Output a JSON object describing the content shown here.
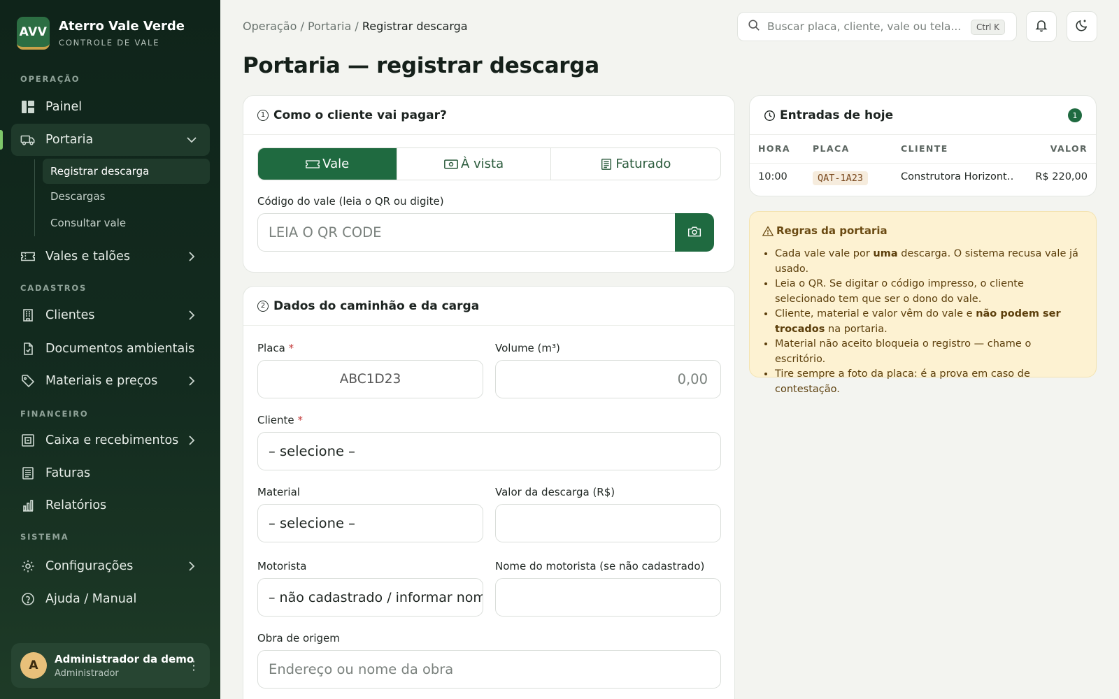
{
  "brand": {
    "logo": "AVV",
    "name": "Aterro Vale Verde",
    "subtitle": "CONTROLE DE VALE"
  },
  "sidebar": {
    "sections": {
      "operacao": "OPERAÇÃO",
      "cadastros": "CADASTROS",
      "financeiro": "FINANCEIRO",
      "sistema": "SISTEMA"
    },
    "items": {
      "painel": "Painel",
      "portaria": "Portaria",
      "vales": "Vales e talões",
      "clientes": "Clientes",
      "documentos": "Documentos ambientais",
      "materiais": "Materiais e preços",
      "caixa": "Caixa e recebimentos",
      "faturas": "Faturas",
      "relatorios": "Relatórios",
      "config": "Configurações",
      "ajuda": "Ajuda / Manual"
    },
    "subitems": {
      "registrar": "Registrar descarga",
      "descargas": "Descargas",
      "consultar": "Consultar vale"
    },
    "user": {
      "initial": "A",
      "name": "Administrador da demo",
      "role": "Administrador"
    }
  },
  "header": {
    "breadcrumb": {
      "a": "Operação",
      "sep": "/",
      "b": "Portaria",
      "c": "Registrar descarga"
    },
    "search_placeholder": "Buscar placa, cliente, vale ou tela...",
    "shortcut": "Ctrl K",
    "title": "Portaria — registrar descarga"
  },
  "payment": {
    "step": "1",
    "title": "Como o cliente vai pagar?",
    "options": {
      "vale": "Vale",
      "avista": "À vista",
      "faturado": "Faturado"
    },
    "selected": "Vale",
    "code_label": "Código do vale (leia o QR ou digite)",
    "code_placeholder": "LEIA O QR CODE"
  },
  "cargo": {
    "step": "2",
    "title": "Dados do caminhão e da carga",
    "placa_label": "Placa",
    "placa_value": "ABC1D23",
    "volume_label": "Volume (m³)",
    "volume_value": "0,00",
    "cliente_label": "Cliente",
    "cliente_value": "– selecione –",
    "material_label": "Material",
    "material_value": "– selecione –",
    "valor_label": "Valor da descarga (R$)",
    "valor_value": "",
    "motorista_label": "Motorista",
    "motorista_value": "– não cadastrado / informar nome",
    "nome_motorista_label": "Nome do motorista (se não cadastrado)",
    "nome_motorista_value": "",
    "obra_label": "Obra de origem",
    "obra_placeholder": "Endereço ou nome da obra",
    "required_mark": "*"
  },
  "today": {
    "title": "Entradas de hoje",
    "count": "1",
    "columns": {
      "hora": "HORA",
      "placa": "PLACA",
      "cliente": "CLIENTE",
      "valor": "VALOR"
    },
    "rows": [
      {
        "hora": "10:00",
        "placa": "QAT-1A23",
        "cliente": "Construtora Horizont…",
        "valor": "R$ 220,00"
      }
    ]
  },
  "rules": {
    "title": "Regras da portaria",
    "r1a": "Cada vale vale por ",
    "r1b": "uma",
    "r1c": " descarga. O sistema recusa vale já usado.",
    "r2": "Leia o QR. Se digitar o código impresso, o cliente selecionado tem que ser o dono do vale.",
    "r3a": "Cliente, material e valor vêm do vale e ",
    "r3b": "não podem ser trocados",
    "r3c": " na portaria.",
    "r4": "Material não aceito bloqueia o registro — chame o escritório.",
    "r5": "Tire sempre a foto da placa: é a prova em caso de contestação."
  },
  "colors": {
    "accent": "#1f6a40",
    "sidebar": "#0f241a",
    "rules_bg": "#fdf2d2"
  }
}
